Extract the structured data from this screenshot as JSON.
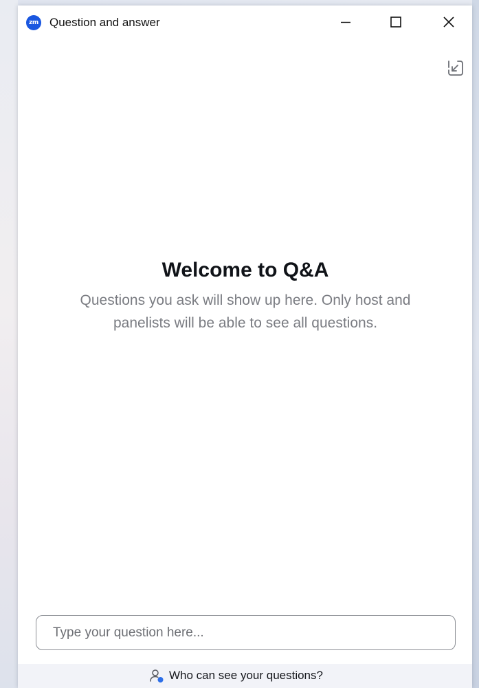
{
  "window": {
    "app_icon_text": "zm",
    "title": "Question and answer"
  },
  "welcome": {
    "title": "Welcome to Q&A",
    "description": "Questions you ask will show up here. Only host and panelists will be able to see all questions."
  },
  "composer": {
    "placeholder": "Type your question here...",
    "value": ""
  },
  "footer": {
    "link_label": "Who can see your questions?"
  },
  "icons": {
    "app": "zoom-logo-icon",
    "minimize": "minimize-icon",
    "maximize": "maximize-icon",
    "close": "close-icon",
    "popin": "pop-in-arrow-icon",
    "visibility": "person-visibility-icon"
  },
  "colors": {
    "brand": "#1a57e0",
    "title_text": "#101318",
    "muted_text": "#7a7c82",
    "footer_bg": "#f2f3f8",
    "badge_dot": "#2d6fe8"
  }
}
